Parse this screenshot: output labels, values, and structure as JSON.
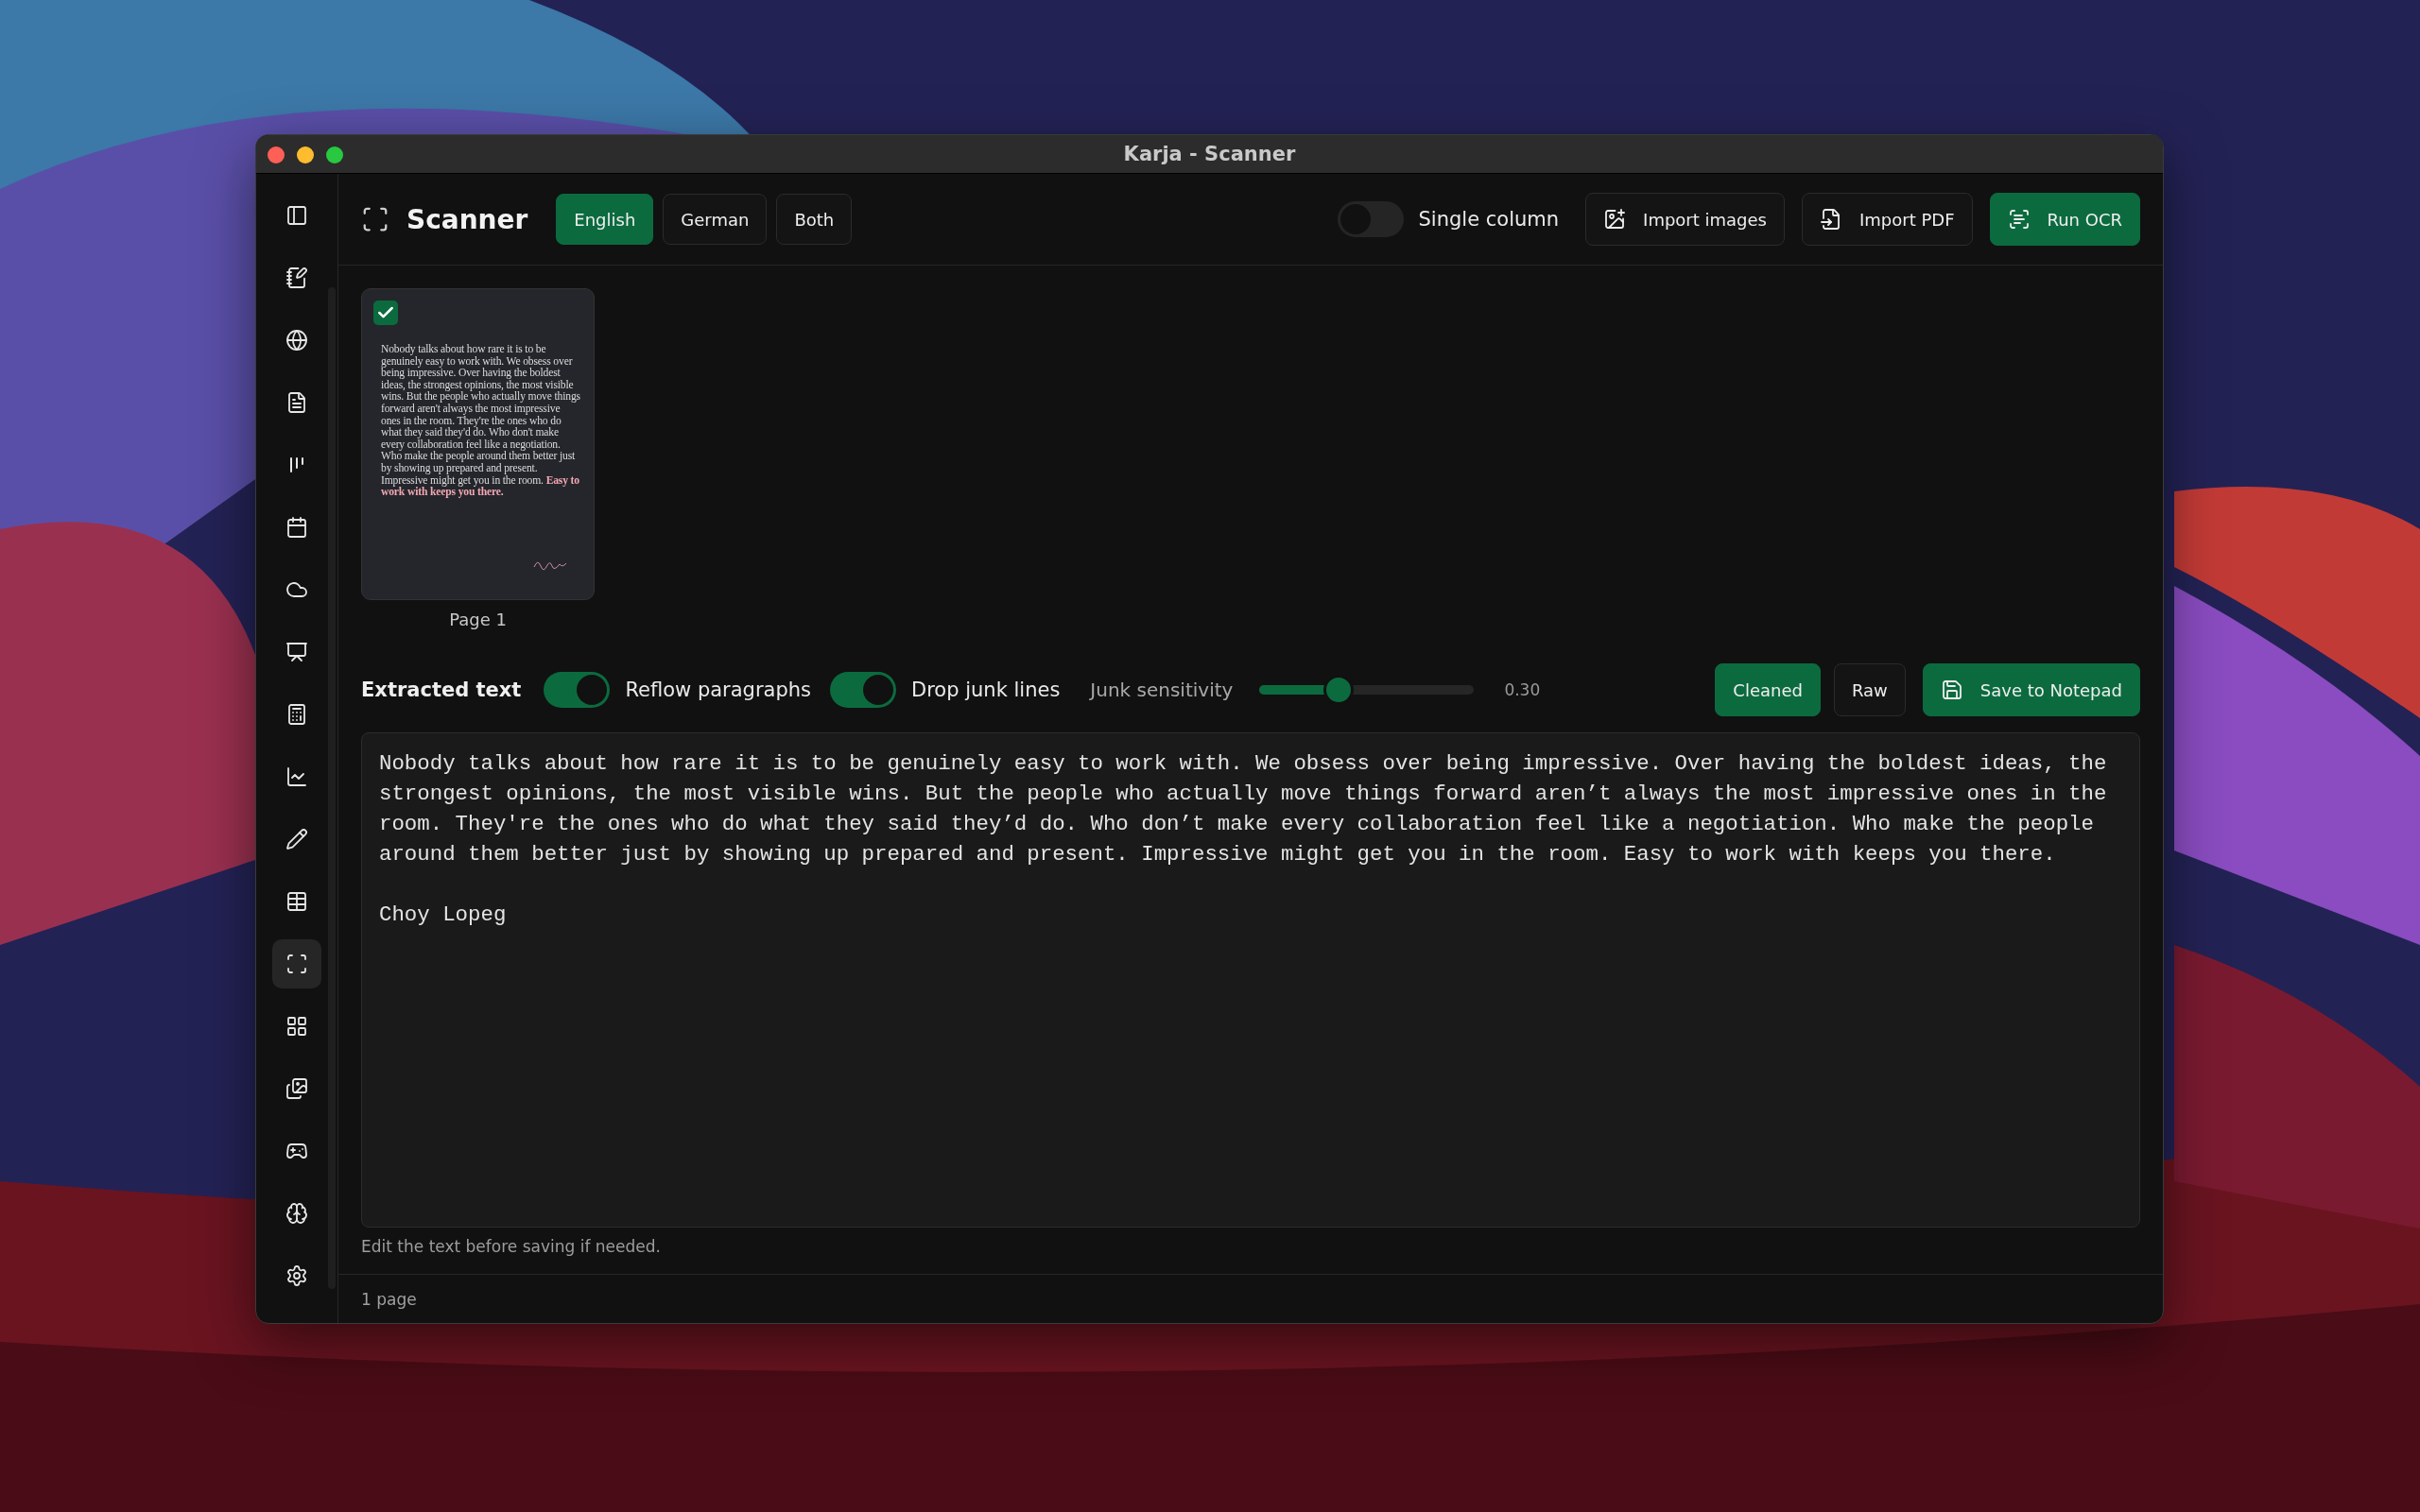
{
  "window": {
    "title": "Karja - Scanner"
  },
  "sidebar": {
    "items": [
      {
        "selected": false
      },
      {
        "selected": false
      },
      {
        "selected": false
      },
      {
        "selected": false
      },
      {
        "selected": false
      },
      {
        "selected": false
      },
      {
        "selected": false
      },
      {
        "selected": false
      },
      {
        "selected": false
      },
      {
        "selected": false
      },
      {
        "selected": false
      },
      {
        "selected": false
      },
      {
        "selected": true
      },
      {
        "selected": false
      },
      {
        "selected": false
      },
      {
        "selected": false
      },
      {
        "selected": false
      },
      {
        "selected": false
      }
    ]
  },
  "header": {
    "title": "Scanner",
    "languages": [
      {
        "label": "English",
        "selected": true
      },
      {
        "label": "German",
        "selected": false
      },
      {
        "label": "Both",
        "selected": false
      }
    ],
    "single_column": {
      "label": "Single column",
      "on": false
    },
    "buttons": [
      {
        "label": "Import images",
        "kind": "images"
      },
      {
        "label": "Import PDF",
        "kind": "pdf"
      },
      {
        "label": "Run OCR",
        "kind": "run"
      }
    ]
  },
  "pages": [
    {
      "label": "Page 1",
      "checked": true,
      "text": "Nobody talks about how rare it is to be genuinely easy to work with. We obsess over being impressive. Over having the boldest ideas, the strongest opinions, the most visible wins. But the people who actually move things forward aren't always the most impressive ones in the room. They're the ones who do what they said they'd do. Who don't make every collaboration feel like a negotiation. Who make the people around them better just by showing up prepared and present. Impressive might get you in the room. **Easy to work with keeps you there.**"
    }
  ],
  "options": {
    "title": "Extracted text",
    "reflow": {
      "label": "Reflow paragraphs",
      "on": true
    },
    "drop_junk": {
      "label": "Drop junk lines",
      "on": true
    },
    "junk_sensitivity": {
      "label": "Junk sensitivity",
      "level": 0.37,
      "reading": "0.30"
    },
    "modes": [
      {
        "label": "Cleaned",
        "selected": true
      },
      {
        "label": "Raw",
        "selected": false
      }
    ],
    "save": {
      "label": "Save to Notepad"
    }
  },
  "editor": {
    "value": "Nobody talks about how rare it is to be genuinely easy to work with. We obsess over being impressive. Over having the boldest ideas, the strongest opinions, the most visible wins. But the people who actually move things forward aren’t always the most impressive ones in the room. They're the ones who do what they said they’d do. Who don’t make every collaboration feel like a negotiation. Who make the people around them better just by showing up prepared and present. Impressive might get you in the room. Easy to work with keeps you there.\n\nChoy Lopeg",
    "hint": "Edit the text before saving if needed."
  },
  "status_bar": {
    "text": "1 page"
  }
}
